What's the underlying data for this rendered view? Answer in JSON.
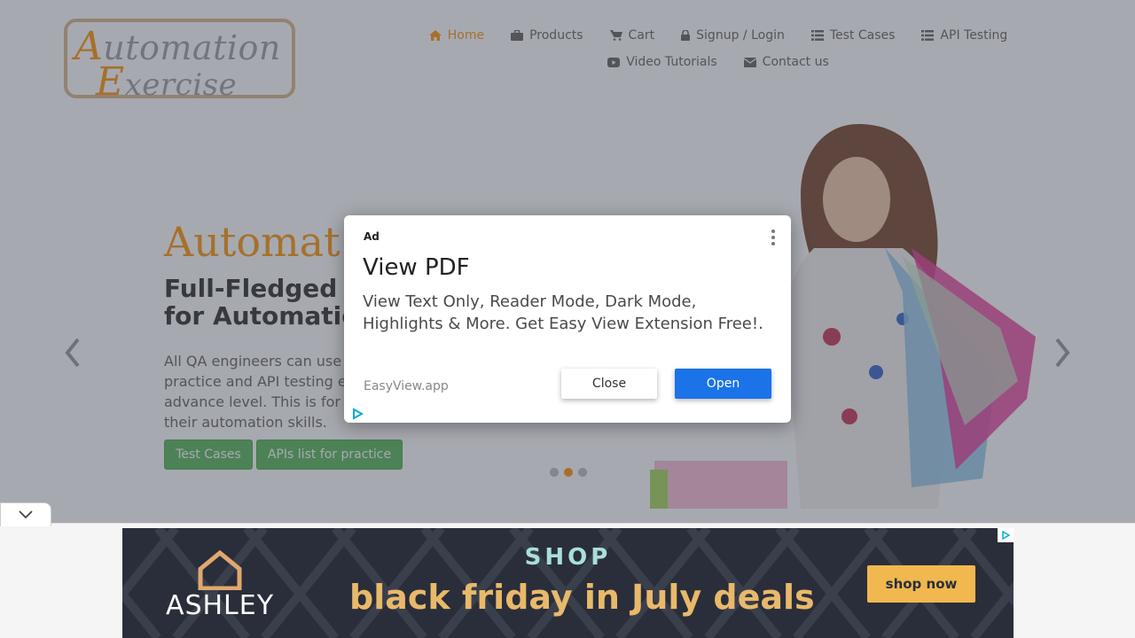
{
  "logo": {
    "line1_cap": "A",
    "line1_rest": "utomation",
    "line2_cap": "E",
    "line2_rest": "xercise"
  },
  "nav": {
    "row1": [
      {
        "label": "Home",
        "icon": "home-icon",
        "active": true
      },
      {
        "label": "Products",
        "icon": "briefcase-icon"
      },
      {
        "label": "Cart",
        "icon": "cart-icon"
      },
      {
        "label": "Signup / Login",
        "icon": "lock-icon"
      },
      {
        "label": "Test Cases",
        "icon": "list-icon"
      },
      {
        "label": "API Testing",
        "icon": "list-icon"
      }
    ],
    "row2": [
      {
        "label": "Video Tutorials",
        "icon": "youtube-icon"
      },
      {
        "label": "Contact us",
        "icon": "envelope-icon"
      }
    ],
    "active_color": "#fe980f"
  },
  "hero": {
    "title": "Automat",
    "subtitle": "Full-Fledged\nfor Automatic",
    "description": "All QA engineers can use\npractice and API testing e\nadvance level. This is for\ntheir automation skills.",
    "btn_test_cases": "Test Cases",
    "btn_apis": "APIs list for practice",
    "slides": 3,
    "active_slide": 2
  },
  "ad": {
    "label": "Ad",
    "title": "View PDF",
    "body": "View Text Only, Reader Mode, Dark Mode, Highlights & More. Get Easy View Extension Free!.",
    "domain": "EasyView.app",
    "close_label": "Close",
    "open_label": "Open"
  },
  "banner": {
    "brand": "ASHLEY",
    "shop": "SHOP",
    "headline": "black friday in July deals",
    "cta": "shop now"
  }
}
